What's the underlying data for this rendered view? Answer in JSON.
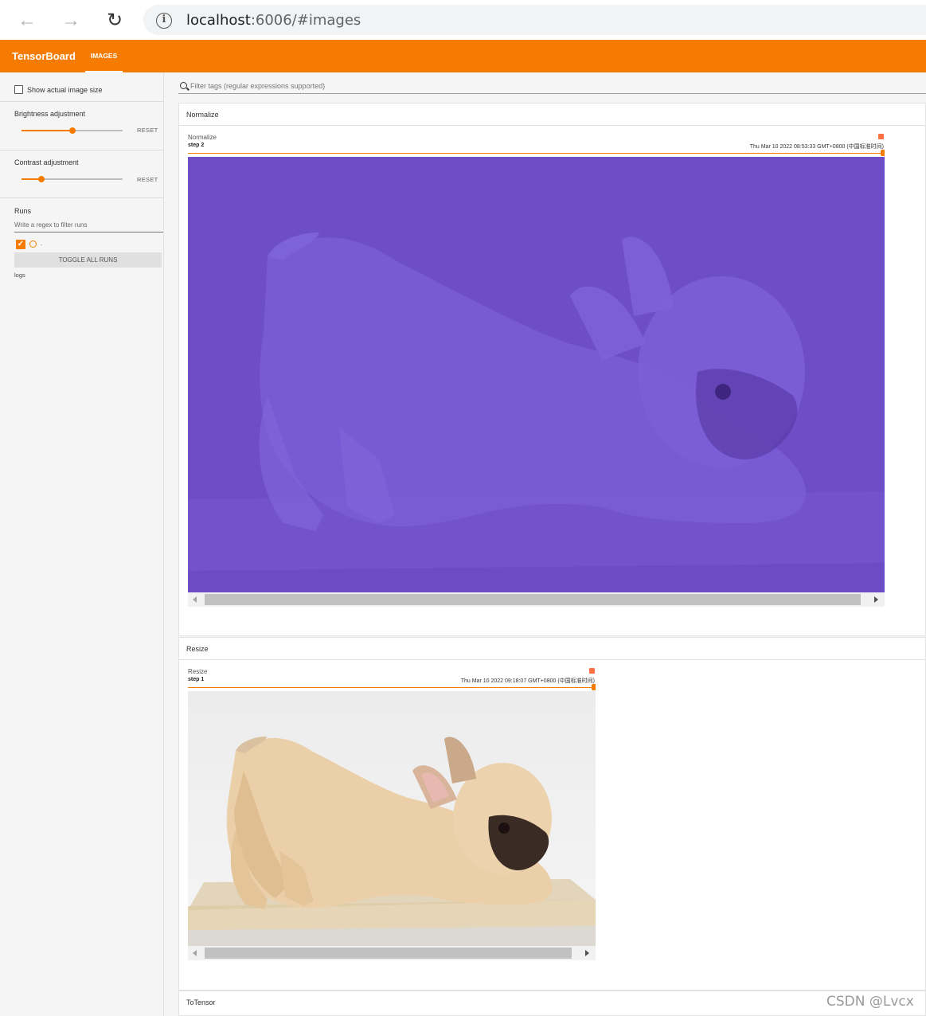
{
  "browser": {
    "url_host": "localhost",
    "url_rest": ":6006/#images",
    "info_icon": "i"
  },
  "app": {
    "title": "TensorBoard",
    "active_tab": "IMAGES",
    "accent_color": "#f57c00"
  },
  "sidebar": {
    "show_actual_size_label": "Show actual image size",
    "show_actual_size_checked": false,
    "brightness": {
      "label": "Brightness adjustment",
      "reset": "RESET",
      "value_fraction": 0.5
    },
    "contrast": {
      "label": "Contrast adjustment",
      "reset": "RESET",
      "value_fraction": 0.2
    },
    "runs": {
      "label": "Runs",
      "filter_placeholder": "Write a regex to filter runs",
      "run_name": ".",
      "run_checked": true,
      "toggle_all": "TOGGLE ALL RUNS",
      "logdir": "logs"
    }
  },
  "main": {
    "filter_placeholder": "Filter tags (regular expressions supported)",
    "categories": [
      {
        "name": "Normalize",
        "card": {
          "tag": "Normalize",
          "step": "step 2",
          "time": "Thu Mar 10 2022 08:53:33 GMT+0800 (中国标准时间)",
          "image_tint": "#6e4ec7"
        }
      },
      {
        "name": "Resize",
        "card": {
          "tag": "Resize",
          "step": "step 1",
          "time": "Thu Mar 10 2022 09:18:07 GMT+0800 (中国标准时间)"
        }
      },
      {
        "name": "ToTensor"
      }
    ]
  },
  "watermark": "CSDN @Lvcx"
}
